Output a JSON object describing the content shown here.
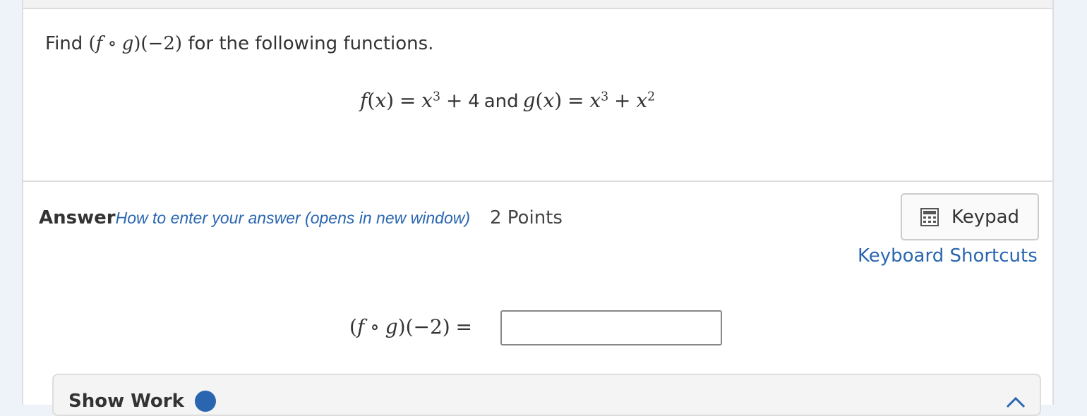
{
  "question": {
    "prompt_prefix": "Find",
    "prompt_suffix": "for the following functions.",
    "formula_f": "x",
    "formula_and": "and",
    "constant": "4",
    "neg_two": "2"
  },
  "answer": {
    "title": "Answer",
    "how_to_link": "How to enter your answer (opens in new window)",
    "points": "2 Points"
  },
  "toolbar": {
    "keypad_label": "Keypad",
    "keypad_icon": "calculator-icon",
    "shortcuts_label": "Keyboard Shortcuts"
  },
  "input": {
    "value": ""
  },
  "show_work": {
    "label": "Show Work",
    "info_icon": "info-icon",
    "toggle_icon": "chevron-up-icon"
  },
  "colors": {
    "link": "#2a66b0",
    "background": "#eef3fa",
    "card": "#ffffff",
    "border": "#dddddd"
  }
}
